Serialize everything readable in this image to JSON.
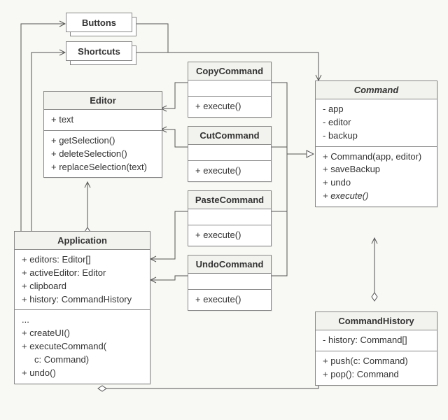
{
  "buttons": {
    "label": "Buttons"
  },
  "shortcuts": {
    "label": "Shortcuts"
  },
  "editor": {
    "title": "Editor",
    "attrs": "+ text",
    "methods": "+ getSelection()\n+ deleteSelection()\n+ replaceSelection(text)"
  },
  "application": {
    "title": "Application",
    "attrs": "+ editors: Editor[]\n+ activeEditor: Editor\n+ clipboard\n+ history: CommandHistory",
    "methods": "...\n+ createUI()\n+ executeCommand(\n     c: Command)\n+ undo()"
  },
  "copy": {
    "title": "CopyCommand",
    "attrs": " ",
    "methods": "+ execute()"
  },
  "cut": {
    "title": "CutCommand",
    "attrs": " ",
    "methods": "+ execute()"
  },
  "paste": {
    "title": "PasteCommand",
    "attrs": " ",
    "methods": "+ execute()"
  },
  "undo": {
    "title": "UndoCommand",
    "attrs": " ",
    "methods": "+ execute()"
  },
  "command": {
    "title": "Command",
    "attrs": "- app\n- editor\n- backup",
    "methods_plain": "+ Command(app, editor)\n+ saveBackup\n+ undo",
    "methods_italic": "+ execute()"
  },
  "history": {
    "title": "CommandHistory",
    "attrs": "- history: Command[]",
    "methods": "+ push(c: Command)\n+ pop(): Command"
  }
}
